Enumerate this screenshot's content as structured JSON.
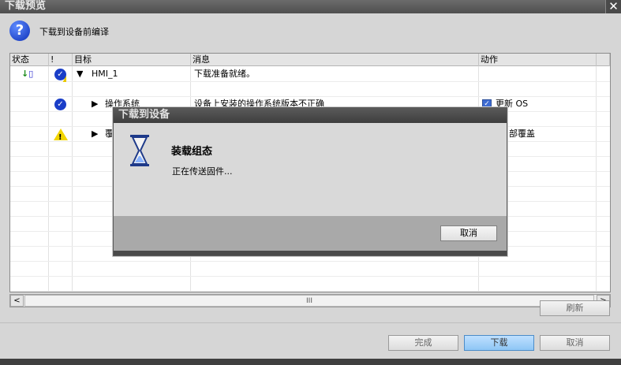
{
  "window": {
    "title": "下载预览",
    "close_glyph": "✕"
  },
  "compile_option": {
    "label": "下载到设备前编译",
    "icon": "help-icon"
  },
  "table": {
    "headers": {
      "status": "状态",
      "flag": "!",
      "target": "目标",
      "message": "消息",
      "action": "动作"
    },
    "rows": {
      "hmi": {
        "target": "HMI_1",
        "message": "下载准备就绪。",
        "action": ""
      },
      "os": {
        "target": "操作系统",
        "message": "设备上安装的操作系统版本不正确",
        "action": "更新 OS"
      },
      "overwrite": {
        "target": "覆",
        "message": "",
        "action": "部覆盖"
      }
    }
  },
  "scrollbar": {
    "left": "<",
    "right": ">",
    "thumb": "III"
  },
  "buttons": {
    "refresh": "刷新",
    "finish": "完成",
    "download": "下载",
    "cancel": "取消"
  },
  "modal": {
    "title": "下载到设备",
    "heading": "装载组态",
    "message": "正在传送固件...",
    "cancel": "取消"
  },
  "colors": {
    "accent": "#8ec6f5",
    "warning": "#f2d500",
    "ok": "#1a3ec8",
    "titlebar": "#4f4f4f"
  }
}
